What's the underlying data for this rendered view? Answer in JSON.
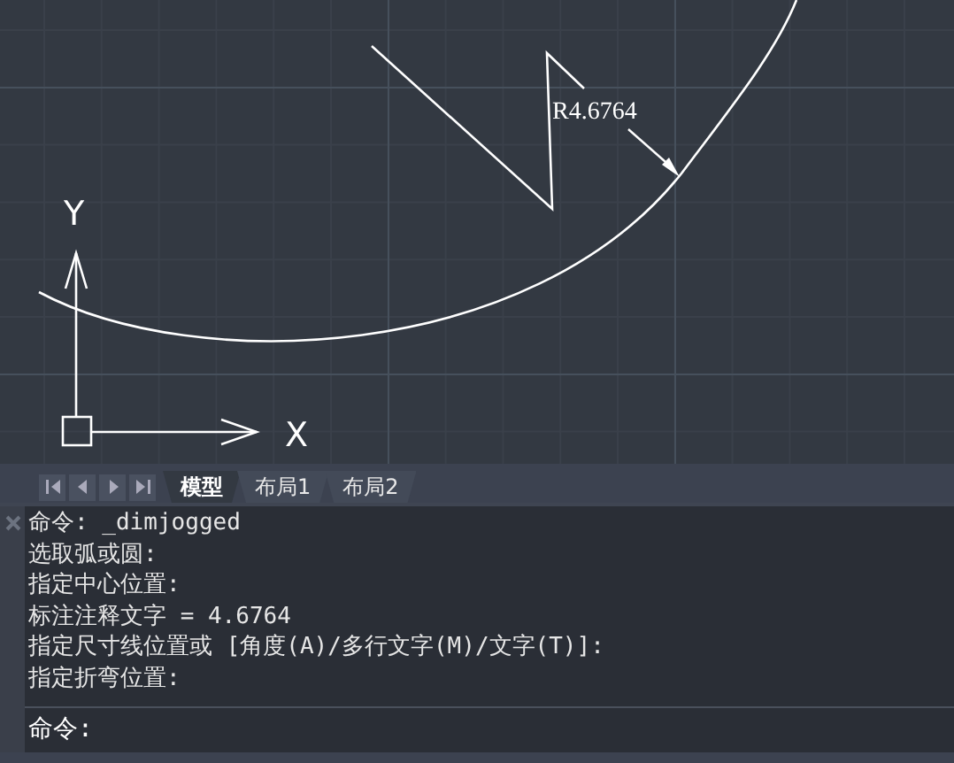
{
  "drawing": {
    "dimension_text": "R4.6764",
    "axis_labels": {
      "y": "Y",
      "x": "X"
    }
  },
  "layout_tabs": [
    {
      "label": "模型",
      "selected": true
    },
    {
      "label": "布局1",
      "selected": false
    },
    {
      "label": "布局2",
      "selected": false
    }
  ],
  "command_history": [
    "命令: _dimjogged",
    "选取弧或圆:",
    "指定中心位置:",
    "标注注释文字 = 4.6764",
    "指定尺寸线位置或 [角度(A)/多行文字(M)/文字(T)]:",
    "指定折弯位置:"
  ],
  "command_prompt": "命令:"
}
